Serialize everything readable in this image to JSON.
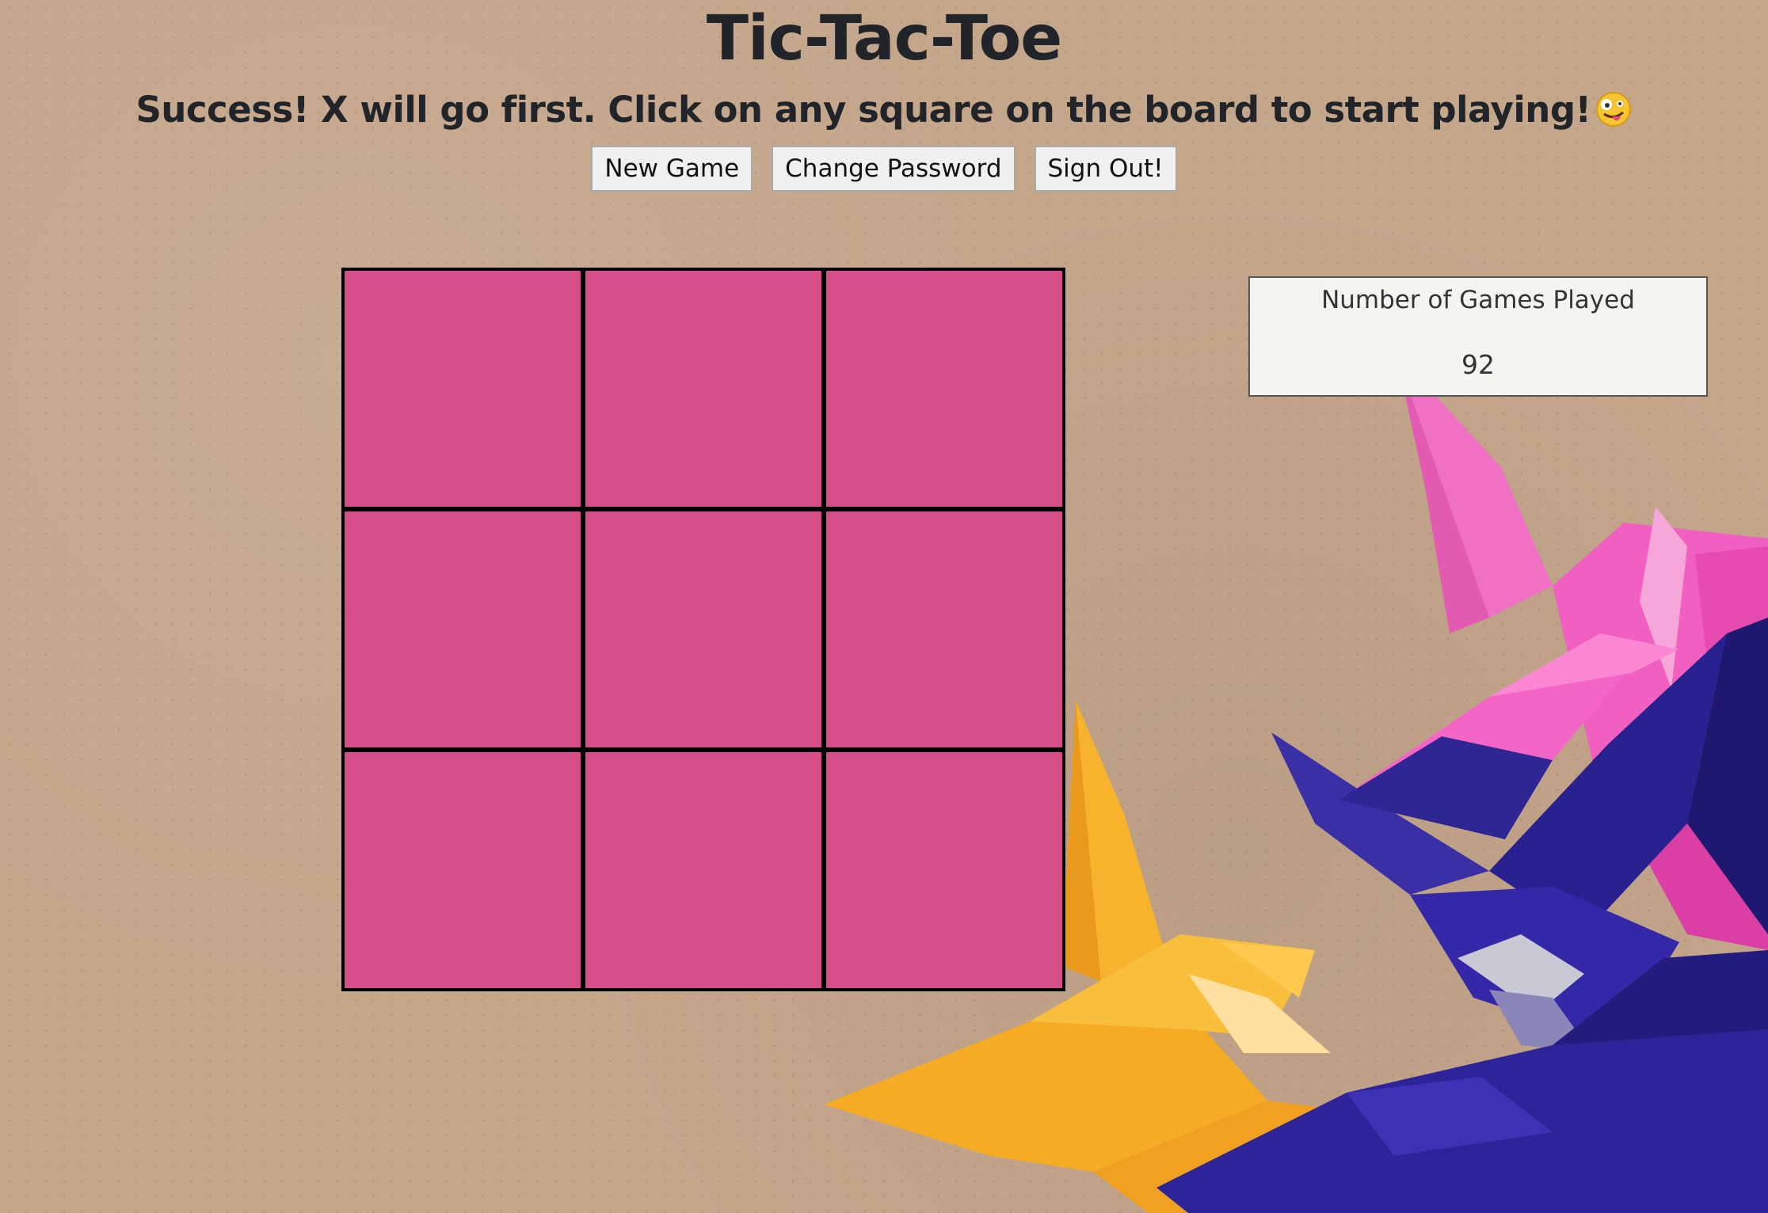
{
  "header": {
    "title": "Tic-Tac-Toe",
    "message": "Success! X will go first. Click on any square on the board to start playing!",
    "message_emoji_icon": "zany-face-emoji-icon"
  },
  "controls": {
    "new_game_label": "New Game",
    "change_password_label": "Change Password",
    "sign_out_label": "Sign Out!"
  },
  "board": {
    "cells": [
      "",
      "",
      "",
      "",
      "",
      "",
      "",
      "",
      ""
    ],
    "cell_color": "#d64f8a",
    "line_color": "#000000"
  },
  "stats": {
    "games_played_label": "Number of Games Played",
    "games_played_count": "92"
  },
  "background": {
    "description_icon": "origami-cranes-on-cardboard-icon",
    "colors": [
      "#c4a68b",
      "#f4a428",
      "#2b2390",
      "#f15fc1"
    ]
  }
}
